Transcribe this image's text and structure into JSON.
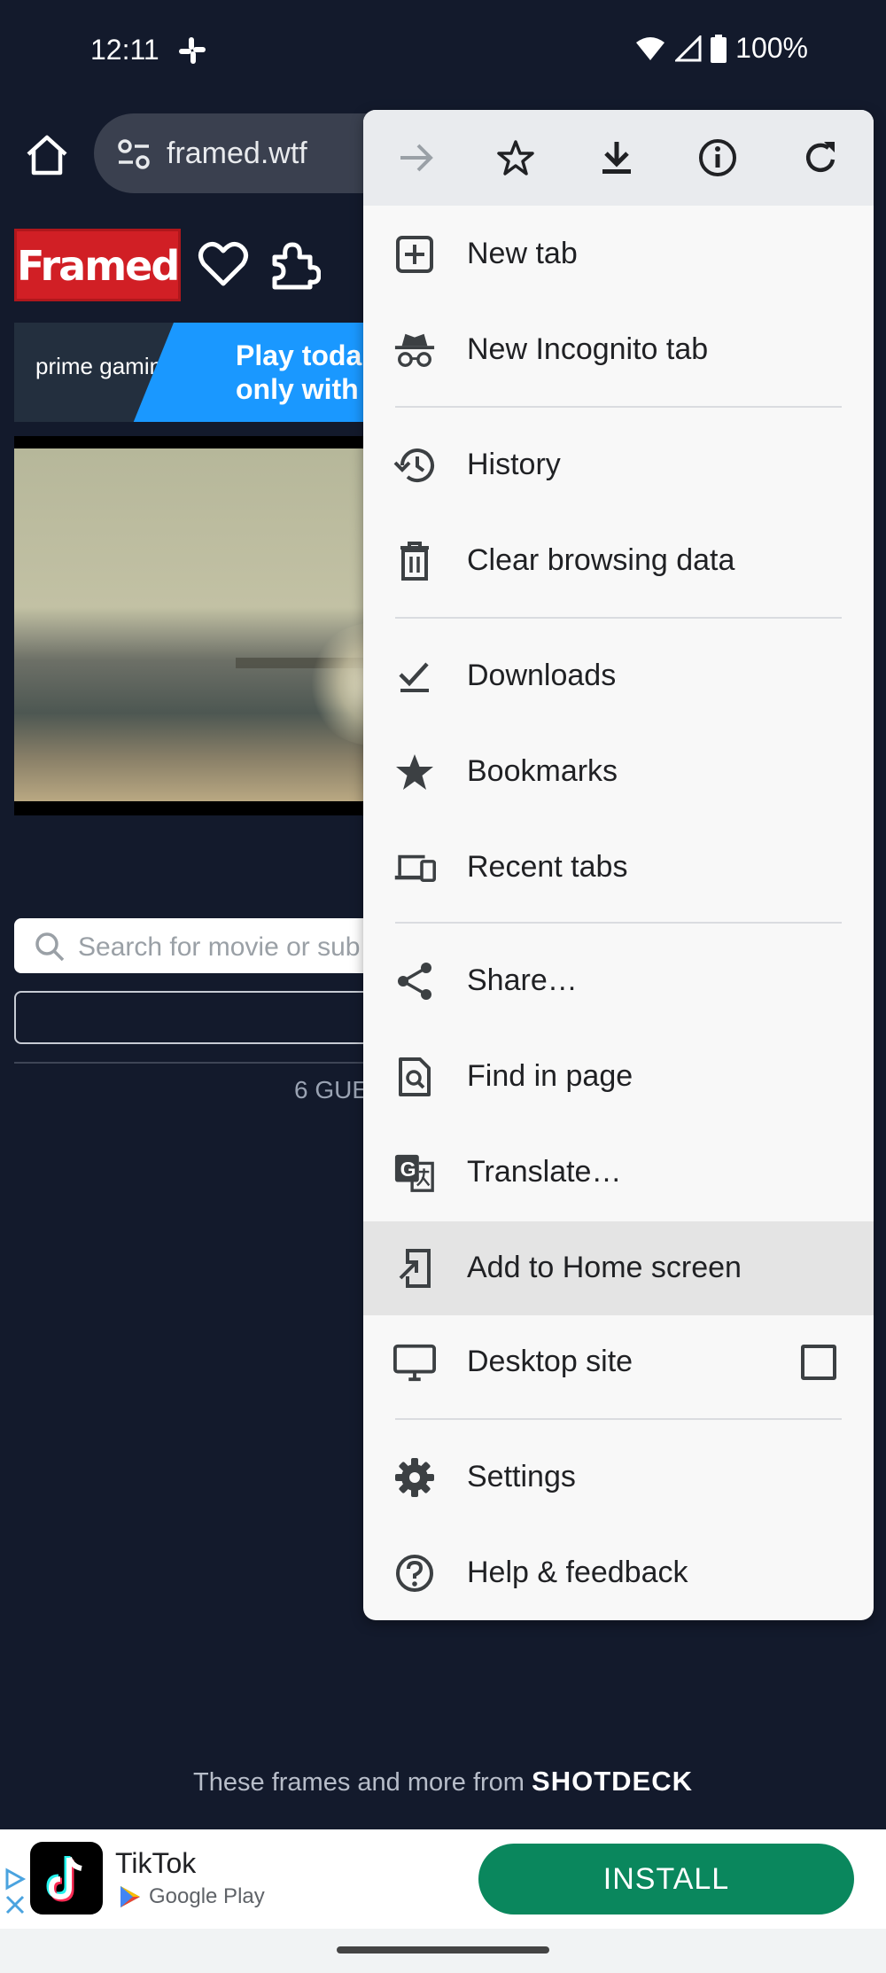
{
  "status_bar": {
    "time": "12:11",
    "battery": "100%"
  },
  "toolbar": {
    "url": "framed.wtf"
  },
  "page": {
    "logo": "Framed",
    "promo": {
      "brand": "prime gaming",
      "line1": "Play toda",
      "line2": "only with"
    },
    "search_placeholder": "Search for movie or sub",
    "guests": "6 GUE",
    "credit_prefix": "These frames and more from",
    "credit_brand": "SHOTDECK"
  },
  "menu": {
    "icon_row": [
      "forward-icon",
      "bookmark-star-icon",
      "download-icon",
      "info-icon",
      "reload-icon"
    ],
    "items": [
      {
        "label": "New tab",
        "icon": "new-tab-icon"
      },
      {
        "label": "New Incognito tab",
        "icon": "incognito-icon"
      },
      {
        "label": "History",
        "icon": "history-icon"
      },
      {
        "label": "Clear browsing data",
        "icon": "trash-icon"
      },
      {
        "label": "Downloads",
        "icon": "downloads-icon"
      },
      {
        "label": "Bookmarks",
        "icon": "star-icon"
      },
      {
        "label": "Recent tabs",
        "icon": "devices-icon"
      },
      {
        "label": "Share…",
        "icon": "share-icon"
      },
      {
        "label": "Find in page",
        "icon": "find-in-page-icon"
      },
      {
        "label": "Translate…",
        "icon": "translate-icon"
      },
      {
        "label": "Add to Home screen",
        "icon": "add-to-home-icon"
      },
      {
        "label": "Desktop site",
        "icon": "desktop-icon",
        "checked": false
      },
      {
        "label": "Settings",
        "icon": "gear-icon"
      },
      {
        "label": "Help & feedback",
        "icon": "help-icon"
      }
    ]
  },
  "ad": {
    "app_name": "TikTok",
    "store": "Google Play",
    "install_label": "INSTALL"
  },
  "colors": {
    "background": "#131a2c",
    "menu_bg": "#f8f8f8",
    "highlight": "#e4e4e4",
    "install_green": "#0a875d",
    "logo_red": "#d11f25"
  }
}
